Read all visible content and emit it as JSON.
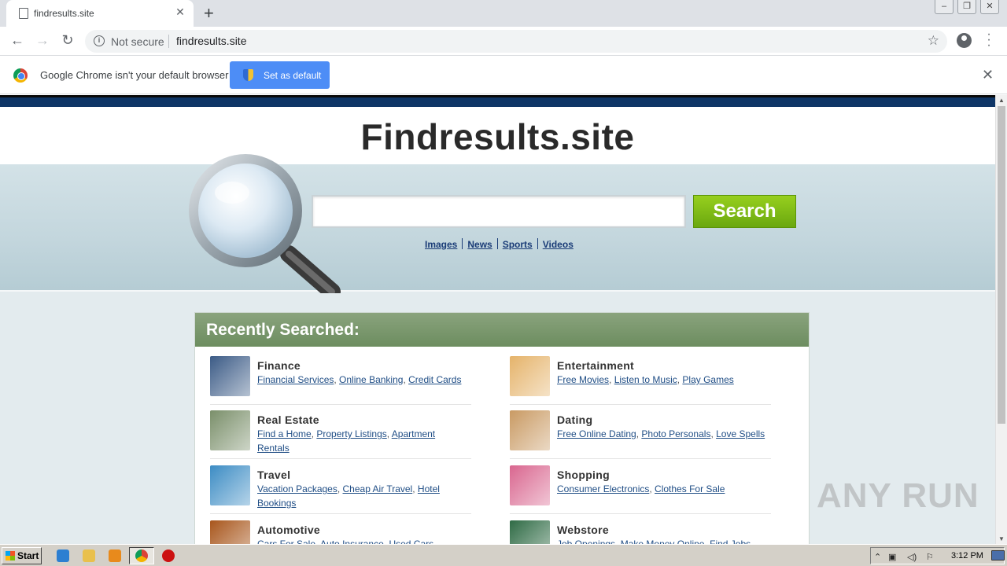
{
  "browser": {
    "tab_title": "findresults.site",
    "tab_close": "✕",
    "new_tab": "+",
    "not_secure": "Not secure",
    "url": "findresults.site",
    "infobar_text": "Google Chrome isn't your default browser",
    "set_default_label": "Set as default",
    "infobar_close": "✕"
  },
  "page": {
    "logo": "Findresults.site",
    "search_button": "Search",
    "search_value": "",
    "vertical_links": [
      "Images",
      "News",
      "Sports",
      "Videos"
    ],
    "recently_searched_title": "Recently Searched:",
    "categories": [
      {
        "name": "Finance",
        "links": [
          "Financial Services",
          "Online Banking",
          "Credit Cards"
        ],
        "thumb_color": "#3b5b86",
        "thumb_icon": "dollar-icon"
      },
      {
        "name": "Entertainment",
        "links": [
          "Free Movies",
          "Listen to Music",
          "Play Games"
        ],
        "thumb_color": "#e5b36a",
        "thumb_icon": "headphones-woman-photo"
      },
      {
        "name": "Real Estate",
        "links": [
          "Find a Home",
          "Property Listings",
          "Apartment Rentals"
        ],
        "thumb_color": "#7a8f6a",
        "thumb_icon": "house-photo"
      },
      {
        "name": "Dating",
        "links": [
          "Free Online Dating",
          "Photo Personals",
          "Love Spells"
        ],
        "thumb_color": "#c99a63",
        "thumb_icon": "couple-photo"
      },
      {
        "name": "Travel",
        "links": [
          "Vacation Packages",
          "Cheap Air Travel",
          "Hotel Bookings"
        ],
        "thumb_color": "#3c8cc4",
        "thumb_icon": "beach-photo"
      },
      {
        "name": "Shopping",
        "links": [
          "Consumer Electronics",
          "Clothes For Sale"
        ],
        "thumb_color": "#d9668f",
        "thumb_icon": "shopping-woman-photo"
      },
      {
        "name": "Automotive",
        "links": [
          "Cars For Sale",
          "Auto Insurance",
          "Used Cars"
        ],
        "thumb_color": "#a8561c",
        "thumb_icon": "car-photo"
      },
      {
        "name": "Webstore",
        "links": [
          "Job Openings",
          "Make Money Online",
          "Find Jobs"
        ],
        "thumb_color": "#2f6b45",
        "thumb_icon": "cash-photo"
      }
    ]
  },
  "watermark": "ANY RUN",
  "taskbar": {
    "start_label": "Start",
    "clock": "3:12 PM"
  },
  "colors": {
    "header_band": "#0e3566",
    "search_button": "#7cbb14",
    "panel_header": "#7a9a6c",
    "link": "#1f4d85"
  }
}
